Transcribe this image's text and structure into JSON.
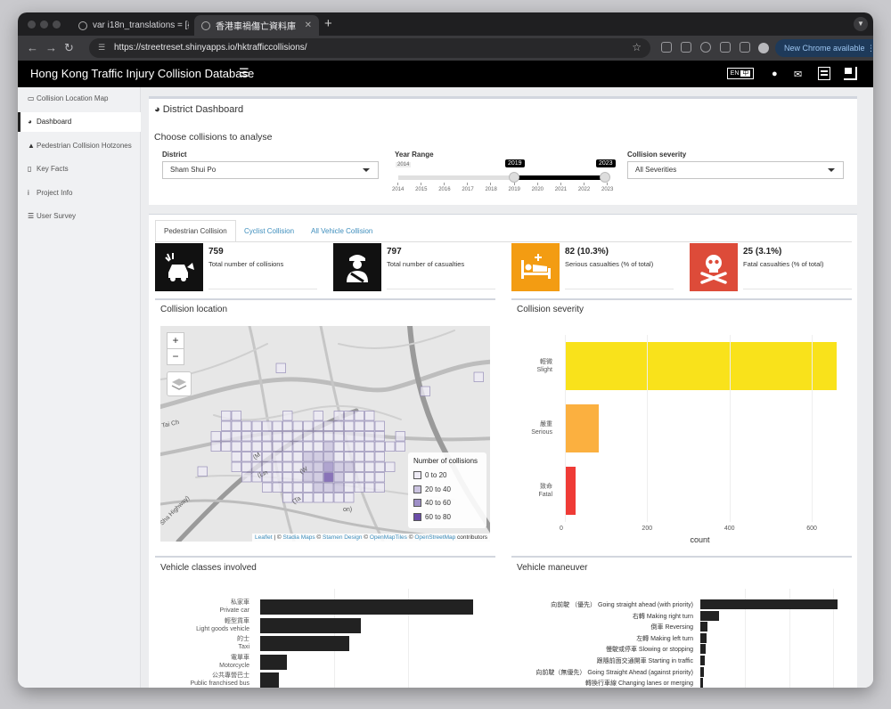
{
  "browser": {
    "tabs": [
      {
        "label": "var i18n_translations = [{\"zh\""
      },
      {
        "label": "香港車禍傷亡資料庫"
      }
    ],
    "url": "https://streetreset.shinyapps.io/hktrafficcollisions/",
    "new_chrome": "New Chrome available"
  },
  "header": {
    "title": "Hong Kong Traffic Injury Collision Database",
    "lang_en": "EN",
    "lang_zh": "中"
  },
  "sidebar": {
    "items": [
      {
        "label": "Collision Location Map",
        "icon": "map-icon"
      },
      {
        "label": "Dashboard",
        "icon": "dashboard-icon"
      },
      {
        "label": "Pedestrian Collision Hotzones",
        "icon": "warning-icon"
      },
      {
        "label": "Key Facts",
        "icon": "book-icon"
      },
      {
        "label": "Project Info",
        "icon": "info-icon"
      },
      {
        "label": "User Survey",
        "icon": "list-icon"
      }
    ]
  },
  "dashboard": {
    "title": "District Dashboard",
    "subtitle": "Choose collisions to analyse",
    "district_label": "District",
    "district_value": "Sham Shui Po",
    "year_label": "Year Range",
    "year_min": "2014",
    "year_from": "2019",
    "year_to": "2023",
    "year_ticks": [
      "2014",
      "2015",
      "2016",
      "2017",
      "2018",
      "2019",
      "2020",
      "2021",
      "2022",
      "2023"
    ],
    "severity_label": "Collision severity",
    "severity_value": "All Severities"
  },
  "tabs": [
    {
      "label": "Pedestrian Collision"
    },
    {
      "label": "Cyclist Collision"
    },
    {
      "label": "All Vehicle Collision"
    }
  ],
  "stats": [
    {
      "value": "759",
      "label": "Total number of collisions",
      "color": "#111111",
      "icon": "car-crash-icon"
    },
    {
      "value": "797",
      "label": "Total number of casualties",
      "color": "#111111",
      "icon": "injured-person-icon"
    },
    {
      "value": "82 (10.3%)",
      "label": "Serious casualties (% of total)",
      "color": "#f39c12",
      "icon": "hospital-bed-icon"
    },
    {
      "value": "25 (3.1%)",
      "label": "Fatal casualties (% of total)",
      "color": "#dd4b39",
      "icon": "skull-icon"
    }
  ],
  "map": {
    "title": "Collision location",
    "zoom_in": "+",
    "zoom_out": "−",
    "road_labels": [
      "Tai Ch",
      "(Lin",
      "(M",
      "(Ta",
      "Sha Highway)",
      "(W",
      "on)"
    ],
    "legend_title": "Number of collisions",
    "legend": [
      {
        "label": "0 to 20",
        "color": "#eeebf5"
      },
      {
        "label": "20 to 40",
        "color": "#cbc4e0"
      },
      {
        "label": "40 to 60",
        "color": "#9e8fc7"
      },
      {
        "label": "60 to 80",
        "color": "#6a4ca8"
      }
    ],
    "attribution": {
      "leaflet": "Leaflet",
      "sep1": " | © ",
      "stadia": "Stadia Maps",
      "sep2": " © ",
      "stamen": "Stamen Design",
      "sep3": " © ",
      "omt": "OpenMapTiles",
      "sep4": " © ",
      "osm": "OpenStreetMap",
      "tail": " contributors"
    }
  },
  "severity_chart": {
    "title": "Collision severity",
    "xlabel": "count",
    "ticks": [
      "0",
      "200",
      "400",
      "600"
    ]
  },
  "vehicle_chart": {
    "title": "Vehicle classes involved"
  },
  "maneuver_chart": {
    "title": "Vehicle maneuver"
  },
  "chart_data": [
    {
      "type": "bar",
      "title": "Collision severity",
      "orientation": "horizontal",
      "categories": [
        {
          "zh": "輕微",
          "en": "Slight"
        },
        {
          "zh": "嚴重",
          "en": "Serious"
        },
        {
          "zh": "致命",
          "en": "Fatal"
        }
      ],
      "values": [
        690,
        82,
        25
      ],
      "colors": [
        "#f9e21b",
        "#fbb040",
        "#ef3b36"
      ],
      "xlabel": "count",
      "xlim": [
        0,
        660
      ]
    },
    {
      "type": "bar",
      "title": "Vehicle classes involved",
      "orientation": "horizontal",
      "categories": [
        {
          "zh": "私家車",
          "en": "Private car"
        },
        {
          "zh": "輕型貨車",
          "en": "Light goods vehicle"
        },
        {
          "zh": "的士",
          "en": "Taxi"
        },
        {
          "zh": "電單車",
          "en": "Motorcycle"
        },
        {
          "zh": "公共專營巴士",
          "en": "Public franchised bus"
        }
      ],
      "values": [
        285,
        135,
        119,
        36,
        25
      ],
      "xlim": [
        0,
        300
      ]
    },
    {
      "type": "bar",
      "title": "Vehicle maneuver",
      "orientation": "horizontal",
      "categories": [
        "向前駛 （優先） Going straight ahead (with priority)",
        "右轉 Making right turn",
        "倒車 Reversing",
        "左轉 Making left turn",
        "慢駛或停車 Slowing or stopping",
        "跟隨前面交通開車 Starting in traffic",
        "向前駛（無優先） Going Straight Ahead (against priority)",
        "轉換行車線 Changing lanes or merging"
      ],
      "values": [
        400,
        55,
        20,
        18,
        15,
        12,
        10,
        8
      ],
      "xlim": [
        0,
        430
      ]
    }
  ]
}
